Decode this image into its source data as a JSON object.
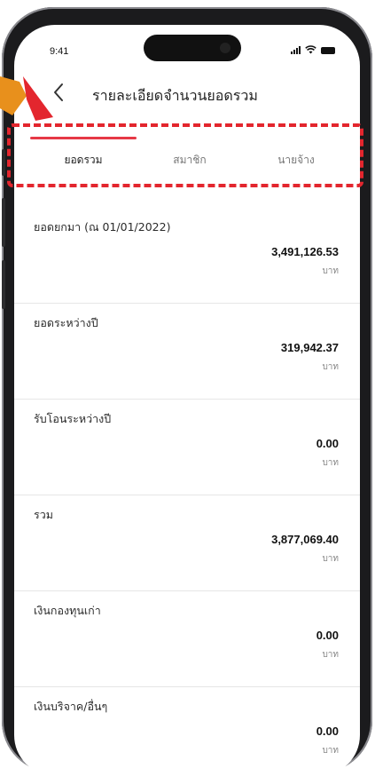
{
  "status_bar": {
    "time": "9:41"
  },
  "header": {
    "title": "รายละเอียดจำนวนยอดรวม"
  },
  "tabs": [
    {
      "label": "ยอดรวม",
      "active": true
    },
    {
      "label": "สมาชิก",
      "active": false
    },
    {
      "label": "นายจ้าง",
      "active": false
    }
  ],
  "rows": [
    {
      "label": "ยอดยกมา (ณ 01/01/2022)",
      "value": "3,491,126.53",
      "unit": "บาท"
    },
    {
      "label": "ยอดระหว่างปี",
      "value": "319,942.37",
      "unit": "บาท"
    },
    {
      "label": "รับโอนระหว่างปี",
      "value": "0.00",
      "unit": "บาท"
    },
    {
      "label": "รวม",
      "value": "3,877,069.40",
      "unit": "บาท"
    },
    {
      "label": "เงินกองทุนเก่า",
      "value": "0.00",
      "unit": "บาท"
    },
    {
      "label": "เงินบริจาค/อื่นๆ",
      "value": "0.00",
      "unit": "บาท"
    }
  ],
  "colors": {
    "accent": "#e63946",
    "annotation_red": "#e3262e",
    "pointer_orange": "#e8901c"
  }
}
